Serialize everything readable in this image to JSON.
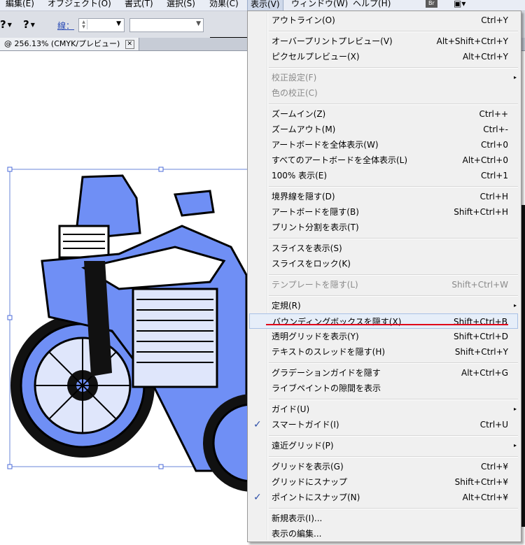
{
  "menubar": {
    "items": [
      "編集(E)",
      "オブジェクト(O)",
      "書式(T)",
      "選択(S)",
      "効果(C)",
      "表示(V)",
      "ウィンドウ(W)",
      "ヘルプ(H)"
    ],
    "active_label": "表示(V)",
    "br_label": "Br"
  },
  "controlbar": {
    "q1": "?",
    "q2": "?",
    "stroke_label": "線：",
    "dd_glyph": "▼"
  },
  "document_tab": {
    "title": "@ 256.13% (CMYK/プレビュー)",
    "close": "✕"
  },
  "menu": {
    "items": [
      {
        "label": "アウトライン(O)",
        "shortcut": "Ctrl+Y"
      },
      {
        "label": "オーバープリントプレビュー(V)",
        "shortcut": "Alt+Shift+Ctrl+Y"
      },
      {
        "label": "ピクセルプレビュー(X)",
        "shortcut": "Alt+Ctrl+Y"
      },
      {
        "label": "校正設定(F)",
        "shortcut": "",
        "submenu": true,
        "disabled": true
      },
      {
        "label": "色の校正(C)",
        "shortcut": "",
        "disabled": true
      },
      {
        "label": "ズームイン(Z)",
        "shortcut": "Ctrl++"
      },
      {
        "label": "ズームアウト(M)",
        "shortcut": "Ctrl+-"
      },
      {
        "label": "アートボードを全体表示(W)",
        "shortcut": "Ctrl+0"
      },
      {
        "label": "すべてのアートボードを全体表示(L)",
        "shortcut": "Alt+Ctrl+0"
      },
      {
        "label": "100% 表示(E)",
        "shortcut": "Ctrl+1"
      },
      {
        "label": "境界線を隠す(D)",
        "shortcut": "Ctrl+H"
      },
      {
        "label": "アートボードを隠す(B)",
        "shortcut": "Shift+Ctrl+H"
      },
      {
        "label": "プリント分割を表示(T)",
        "shortcut": ""
      },
      {
        "label": "スライスを表示(S)",
        "shortcut": ""
      },
      {
        "label": "スライスをロック(K)",
        "shortcut": ""
      },
      {
        "label": "テンプレートを隠す(L)",
        "shortcut": "Shift+Ctrl+W",
        "disabled": true
      },
      {
        "label": "定規(R)",
        "shortcut": "",
        "submenu": true
      },
      {
        "label": "バウンディングボックスを隠す(X)",
        "shortcut": "Shift+Ctrl+B",
        "highlighted": true
      },
      {
        "label": "透明グリッドを表示(Y)",
        "shortcut": "Shift+Ctrl+D"
      },
      {
        "label": "テキストのスレッドを隠す(H)",
        "shortcut": "Shift+Ctrl+Y"
      },
      {
        "label": "グラデーションガイドを隠す",
        "shortcut": "Alt+Ctrl+G"
      },
      {
        "label": "ライブペイントの隙間を表示",
        "shortcut": ""
      },
      {
        "label": "ガイド(U)",
        "shortcut": "",
        "submenu": true
      },
      {
        "label": "スマートガイド(I)",
        "shortcut": "Ctrl+U",
        "checked": true
      },
      {
        "label": "遠近グリッド(P)",
        "shortcut": "",
        "submenu": true
      },
      {
        "label": "グリッドを表示(G)",
        "shortcut": "Ctrl+¥"
      },
      {
        "label": "グリッドにスナップ",
        "shortcut": "Shift+Ctrl+¥"
      },
      {
        "label": "ポイントにスナップ(N)",
        "shortcut": "Alt+Ctrl+¥",
        "checked": true
      },
      {
        "label": "新規表示(I)...",
        "shortcut": ""
      },
      {
        "label": "表示の編集...",
        "shortcut": ""
      }
    ],
    "submenu_glyph": "▸",
    "check_glyph": "✓"
  },
  "colors": {
    "selection": "#3366ff",
    "highlight_underline": "#e0001a"
  }
}
